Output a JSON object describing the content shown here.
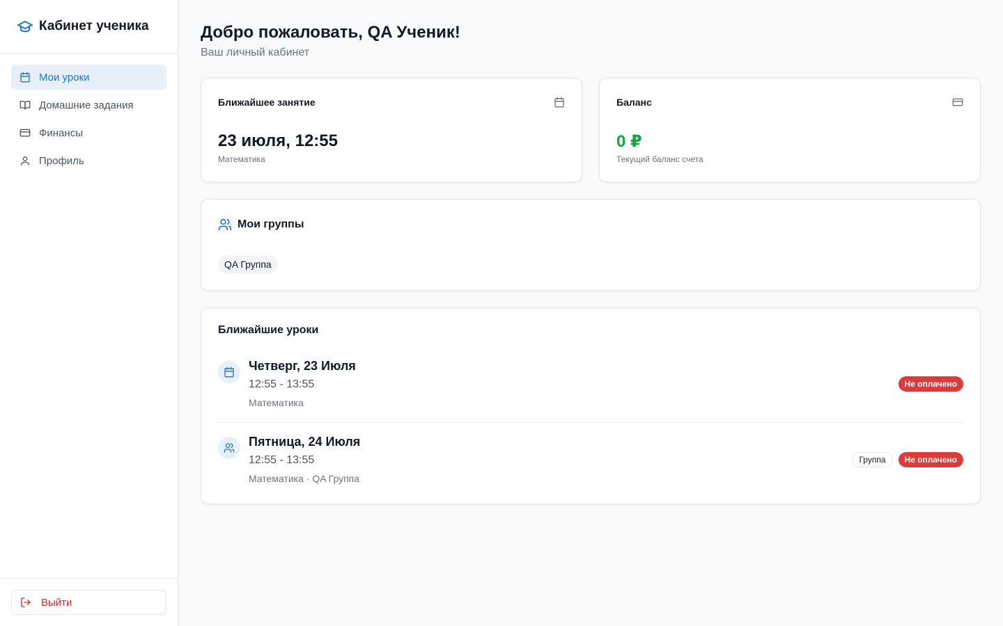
{
  "sidebar": {
    "brand": {
      "title": "Кабинет ученика",
      "icon": "graduation-cap-icon"
    },
    "items": [
      {
        "label": "Мои уроки",
        "icon": "calendar-icon",
        "active": true
      },
      {
        "label": "Домашние задания",
        "icon": "book-open-icon",
        "active": false
      },
      {
        "label": "Финансы",
        "icon": "credit-card-icon",
        "active": false
      },
      {
        "label": "Профиль",
        "icon": "user-icon",
        "active": false
      }
    ],
    "logout": {
      "label": "Выйти",
      "icon": "log-out-icon"
    }
  },
  "header": {
    "title": "Добро пожаловать, QA Ученик!",
    "subtitle": "Ваш личный кабинет"
  },
  "stats": {
    "next_lesson": {
      "label": "Ближайшее занятие",
      "value": "23 июля, 12:55",
      "sub": "Математика",
      "icon": "calendar-icon"
    },
    "balance": {
      "label": "Баланс",
      "value": "0 ₽",
      "sub": "Текущий баланс счета",
      "icon": "credit-card-icon",
      "value_color": "#16a34a"
    }
  },
  "groups": {
    "title": "Мои группы",
    "icon": "users-icon",
    "items": [
      "QA Группа"
    ]
  },
  "lessons": {
    "title": "Ближайшие уроки",
    "items": [
      {
        "date": "Четверг, 23 Июля",
        "time": "12:55 - 13:55",
        "meta": "Математика",
        "icon": "calendar-icon",
        "badges": [
          "Не оплачено"
        ]
      },
      {
        "date": "Пятница, 24 Июля",
        "time": "12:55 - 13:55",
        "meta": "Математика · QA Группа",
        "icon": "users-icon",
        "badges": [
          "Группа",
          "Не оплачено"
        ]
      }
    ]
  },
  "colors": {
    "accent": "#1d76d2",
    "accent_bg": "#e6effa",
    "danger": "#dc3b3b",
    "success": "#16a34a"
  }
}
